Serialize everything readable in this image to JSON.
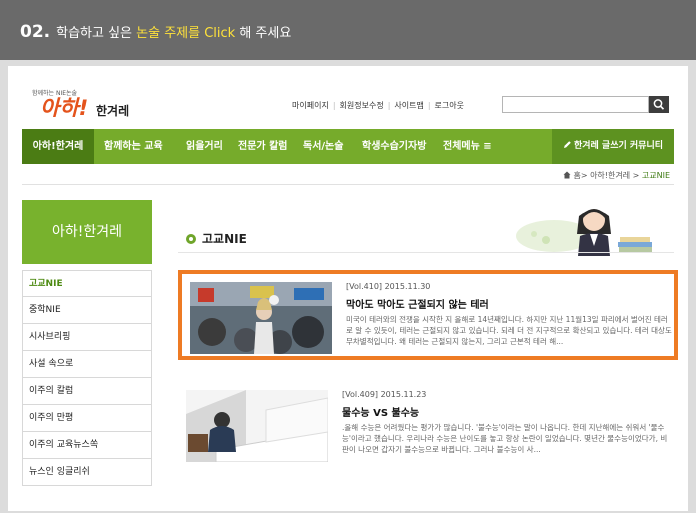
{
  "instruction": {
    "step": "02.",
    "before": "학습하고 싶은 ",
    "highlight": "논술 주제를 Click",
    "after": " 해 주세요",
    "highlight_color": "#ffe23a"
  },
  "header": {
    "logo_small": "함께하는 NIE논술",
    "logo_aha": "아하!",
    "logo_han": "한겨레",
    "util_links": [
      "마이페이지",
      "회원정보수정",
      "사이트맵",
      "로그아웃"
    ]
  },
  "nav": {
    "items": [
      "아하!한겨레",
      "함께하는 교육",
      "읽을거리",
      "전문가 칼럼",
      "독서/논술",
      "학생수습기자방",
      "전체메뉴 ≡"
    ],
    "right": "한겨레 글쓰기 커뮤니티",
    "color": "#76ab2b"
  },
  "breadcrumb": {
    "home": "홈",
    "parent": "아하!한겨레",
    "current": "고교NIE"
  },
  "side": {
    "header": "아하!한겨레",
    "items": [
      "고교NIE",
      "중학NIE",
      "시사브리핑",
      "사설 속으로",
      "이주의 칼럼",
      "이주의 만평",
      "이주의 교육뉴스쏙",
      "뉴스인 잉글리쉬"
    ]
  },
  "section": {
    "title": "고교NIE"
  },
  "articles": [
    {
      "vol": "[Vol.410]",
      "date": "2015.11.30",
      "title": "막아도 막아도 근절되지 않는 테러",
      "summary": "미국이 테러와의 전쟁을 시작한 지 올해로 14년째입니다. 하지만 지난 11월13일 파리에서 벌어진 테러로 알 수 있듯이, 테러는 근절되지 않고 있습니다. 되레 더 전 지구적으로 확산되고 있습니다. 테러 대상도 무차별적입니다. 왜 테러는 근절되지 않는지, 그리고 근본적 테러 해..."
    },
    {
      "vol": "[Vol.409]",
      "date": "2015.11.23",
      "title": "물수능 VS 불수능",
      "summary": ".올해 수능은 어려웠다는 평가가 많습니다. '불수능'이라는 말이 나옵니다. 한데 지난해에는 쉬워서 '물수능'이라고 했습니다. 우리나라 수능은 난이도를 놓고 항상 논란이 일었습니다. 몇년간 물수능이었다가, 비판이 나오면 갑자기 불수능으로 바뀝니다. 그러나 불수능이 사..."
    }
  ],
  "selection_color": "#ee7b24"
}
